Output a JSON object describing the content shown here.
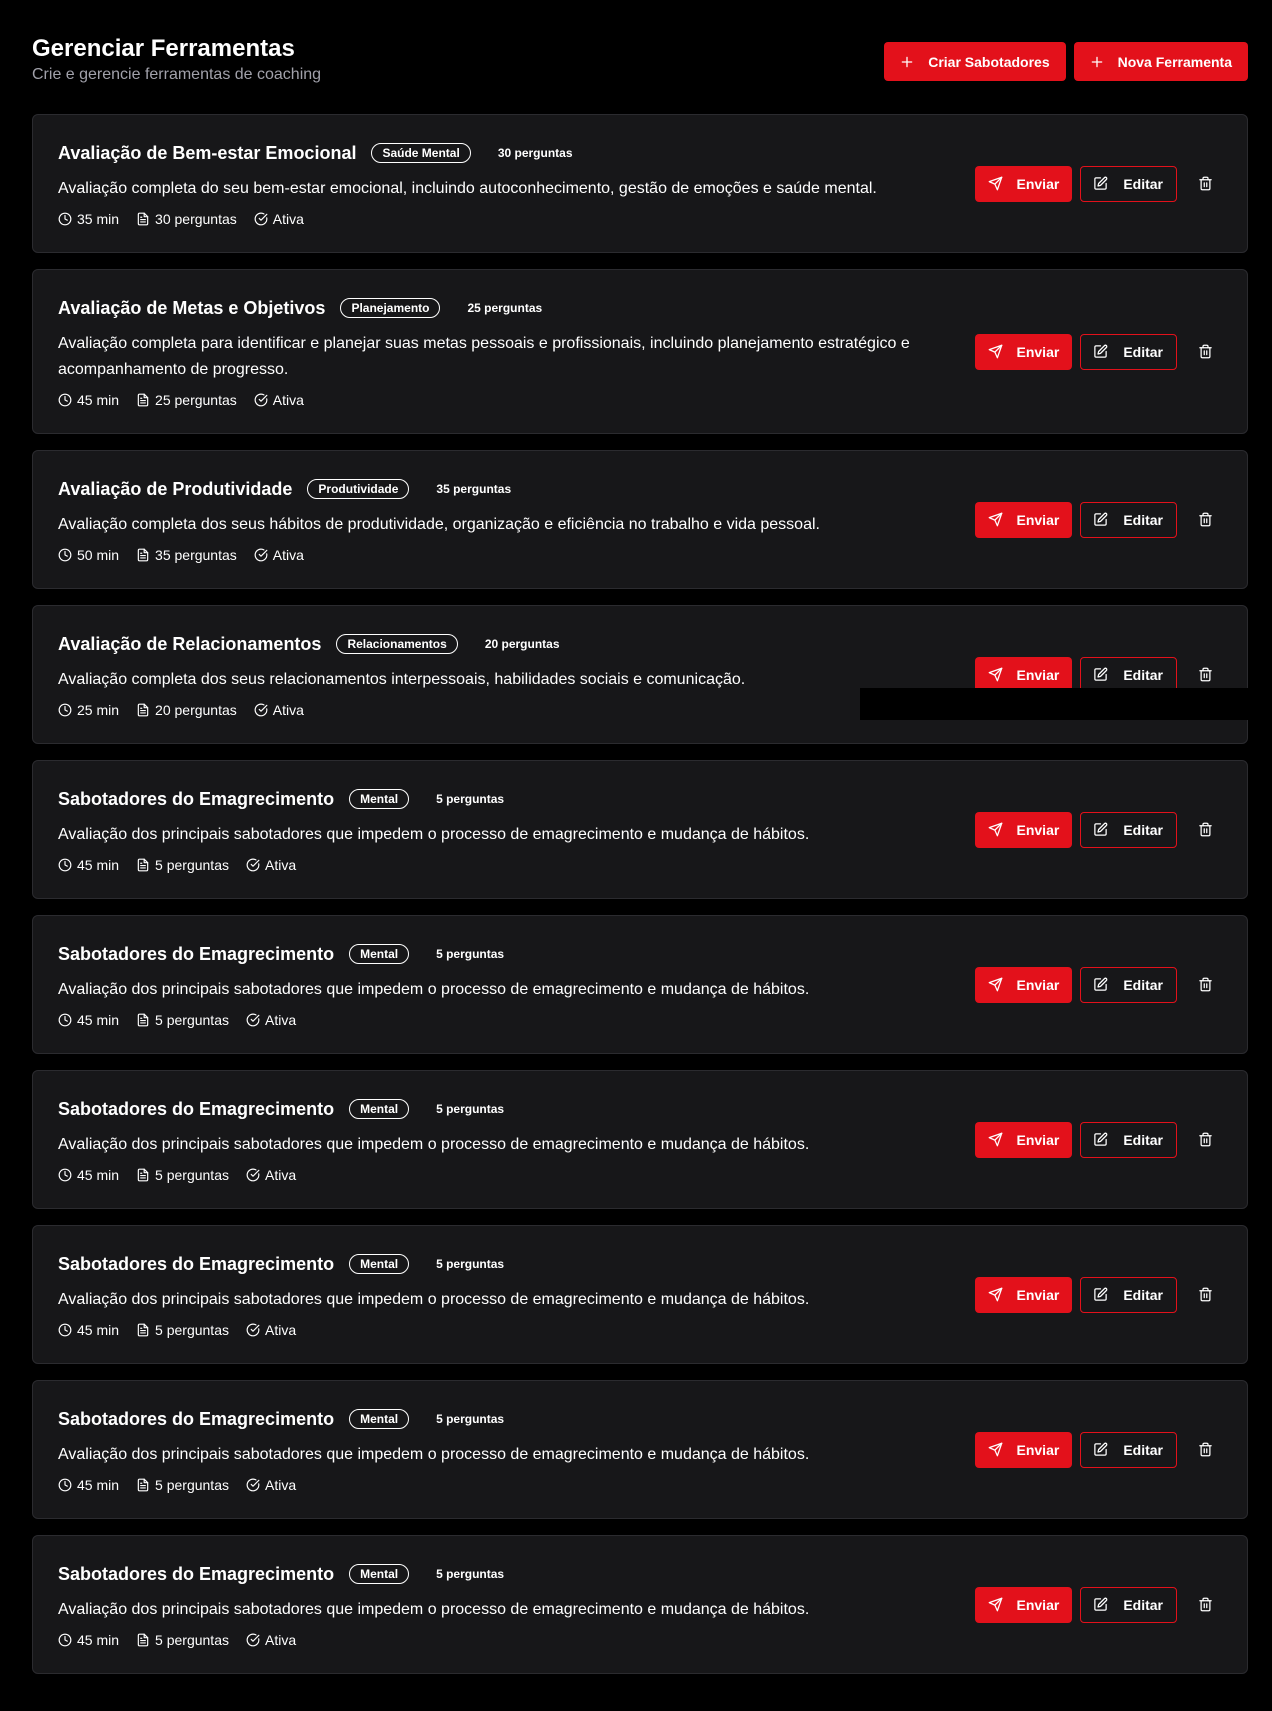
{
  "header": {
    "title": "Gerenciar Ferramentas",
    "subtitle": "Crie e gerencie ferramentas de coaching",
    "buttons": {
      "create_saboteurs": "Criar Sabotadores",
      "new_tool": "Nova Ferramenta"
    }
  },
  "colors": {
    "accent": "#e3111b",
    "background": "#000000",
    "card": "#171719",
    "muted_text": "#a1a1aa"
  },
  "icons": {
    "header_buttons": "plus-icon",
    "duration": "clock-icon",
    "questions": "file-text-icon",
    "status": "check-circle-icon",
    "send": "send-icon",
    "edit": "edit-icon",
    "delete": "trash-icon"
  },
  "actions": {
    "send_label": "Enviar",
    "edit_label": "Editar"
  },
  "tools": [
    {
      "title": "Avaliação de Bem-estar Emocional",
      "category": "Saúde Mental",
      "questions_label": "30 perguntas",
      "description": "Avaliação completa do seu bem-estar emocional, incluindo autoconhecimento, gestão de emoções e saúde mental.",
      "duration": "35 min",
      "questions": "30 perguntas",
      "status": "Ativa"
    },
    {
      "title": "Avaliação de Metas e Objetivos",
      "category": "Planejamento",
      "questions_label": "25 perguntas",
      "description": "Avaliação completa para identificar e planejar suas metas pessoais e profissionais, incluindo planejamento estratégico e acompanhamento de progresso.",
      "duration": "45 min",
      "questions": "25 perguntas",
      "status": "Ativa"
    },
    {
      "title": "Avaliação de Produtividade",
      "category": "Produtividade",
      "questions_label": "35 perguntas",
      "description": "Avaliação completa dos seus hábitos de produtividade, organização e eficiência no trabalho e vida pessoal.",
      "duration": "50 min",
      "questions": "35 perguntas",
      "status": "Ativa"
    },
    {
      "title": "Avaliação de Relacionamentos",
      "category": "Relacionamentos",
      "questions_label": "20 perguntas",
      "description": "Avaliação completa dos seus relacionamentos interpessoais, habilidades sociais e comunicação.",
      "duration": "25 min",
      "questions": "20 perguntas",
      "status": "Ativa"
    },
    {
      "title": "Sabotadores do Emagrecimento",
      "category": "Mental",
      "questions_label": "5 perguntas",
      "description": "Avaliação dos principais sabotadores que impedem o processo de emagrecimento e mudança de hábitos.",
      "duration": "45 min",
      "questions": "5 perguntas",
      "status": "Ativa"
    },
    {
      "title": "Sabotadores do Emagrecimento",
      "category": "Mental",
      "questions_label": "5 perguntas",
      "description": "Avaliação dos principais sabotadores que impedem o processo de emagrecimento e mudança de hábitos.",
      "duration": "45 min",
      "questions": "5 perguntas",
      "status": "Ativa"
    },
    {
      "title": "Sabotadores do Emagrecimento",
      "category": "Mental",
      "questions_label": "5 perguntas",
      "description": "Avaliação dos principais sabotadores que impedem o processo de emagrecimento e mudança de hábitos.",
      "duration": "45 min",
      "questions": "5 perguntas",
      "status": "Ativa"
    },
    {
      "title": "Sabotadores do Emagrecimento",
      "category": "Mental",
      "questions_label": "5 perguntas",
      "description": "Avaliação dos principais sabotadores que impedem o processo de emagrecimento e mudança de hábitos.",
      "duration": "45 min",
      "questions": "5 perguntas",
      "status": "Ativa"
    },
    {
      "title": "Sabotadores do Emagrecimento",
      "category": "Mental",
      "questions_label": "5 perguntas",
      "description": "Avaliação dos principais sabotadores que impedem o processo de emagrecimento e mudança de hábitos.",
      "duration": "45 min",
      "questions": "5 perguntas",
      "status": "Ativa"
    },
    {
      "title": "Sabotadores do Emagrecimento",
      "category": "Mental",
      "questions_label": "5 perguntas",
      "description": "Avaliação dos principais sabotadores que impedem o processo de emagrecimento e mudança de hábitos.",
      "duration": "45 min",
      "questions": "5 perguntas",
      "status": "Ativa"
    }
  ]
}
